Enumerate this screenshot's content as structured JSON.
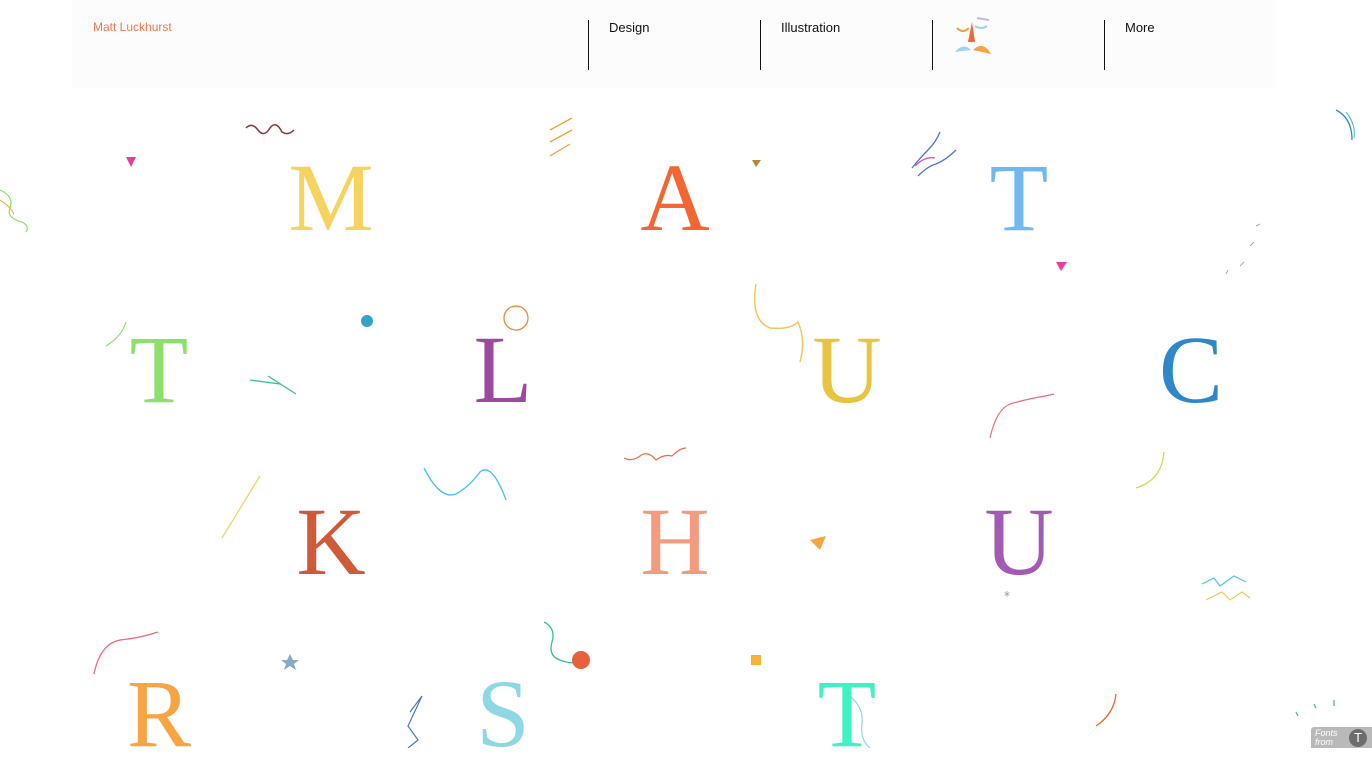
{
  "header": {
    "brand": "Matt Luckhurst",
    "nav": [
      {
        "label": "Design"
      },
      {
        "label": "Illustration"
      },
      {
        "label": ""
      },
      {
        "label": "More"
      }
    ]
  },
  "letters": [
    "M",
    "A",
    "T",
    "T",
    "L",
    "U",
    "C",
    "K",
    "H",
    "U",
    "R",
    "S",
    "T"
  ],
  "colors": {
    "brand": "#ee7a52",
    "letters": [
      "#f6d35e",
      "#f26634",
      "#6fb9f2",
      "#8ee06a",
      "#9b4a9e",
      "#e7c441",
      "#2f87c9",
      "#cf5a3a",
      "#f29b7e",
      "#a35ab5",
      "#f7a443",
      "#8ed8e3",
      "#3df3c4"
    ]
  },
  "footer": {
    "fonts_badge": "Fonts from",
    "fonts_icon": "typekit-icon"
  }
}
